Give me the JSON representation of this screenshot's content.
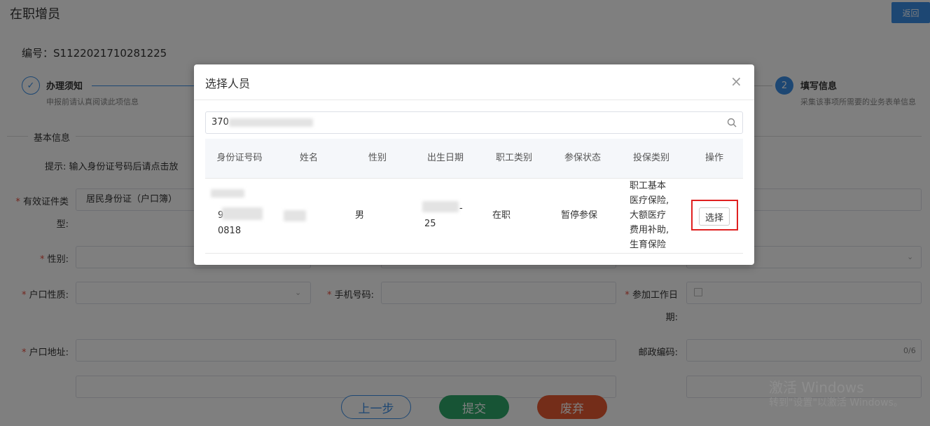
{
  "page": {
    "title": "在职增员",
    "back_label": "返回",
    "code_label": "编号：S1122021710281225",
    "steps": [
      {
        "title": "办理须知",
        "desc": "申报前请认真阅读此项信息",
        "mark": "✓"
      },
      {
        "title": "填写信息",
        "desc": "采集该事项所需要的业务表单信息",
        "mark": "2"
      }
    ],
    "section_title": "基本信息",
    "hint": "提示:   输入身份证号码后请点击放",
    "form": {
      "id_type_label_1": "有效证件类",
      "id_type_label_2": "型:",
      "id_type_value": "居民身份证（户口簿）",
      "gender_label": "性别:",
      "hukou_type_label": "户口性质:",
      "phone_label": "手机号码:",
      "work_date_label_1": "参加工作日",
      "work_date_label_2": "期:",
      "address_label": "户口地址:",
      "postcode_label": "邮政编码:",
      "postcode_counter": "0/6"
    },
    "buttons": {
      "prev": "上一步",
      "submit": "提交",
      "discard": "废弃"
    }
  },
  "watermark": {
    "line1": "激活 Windows",
    "line2": "转到\"设置\"以激活 Windows。"
  },
  "dialog": {
    "title": "选择人员",
    "search_value": "370",
    "table": {
      "headers": [
        "身份证号码",
        "姓名",
        "性别",
        "出生日期",
        "职工类别",
        "参保状态",
        "投保类别",
        "操作"
      ],
      "row": {
        "id_line1": "9",
        "id_line2": "0818",
        "gender": "男",
        "birth_suffix": "-",
        "birth_line2": "25",
        "worker_type": "在职",
        "status": "暂停参保",
        "insurance_lines": [
          "职工基本",
          "医疗保险,",
          "大额医疗",
          "费用补助,",
          "生育保险"
        ],
        "action": "选择"
      }
    }
  }
}
